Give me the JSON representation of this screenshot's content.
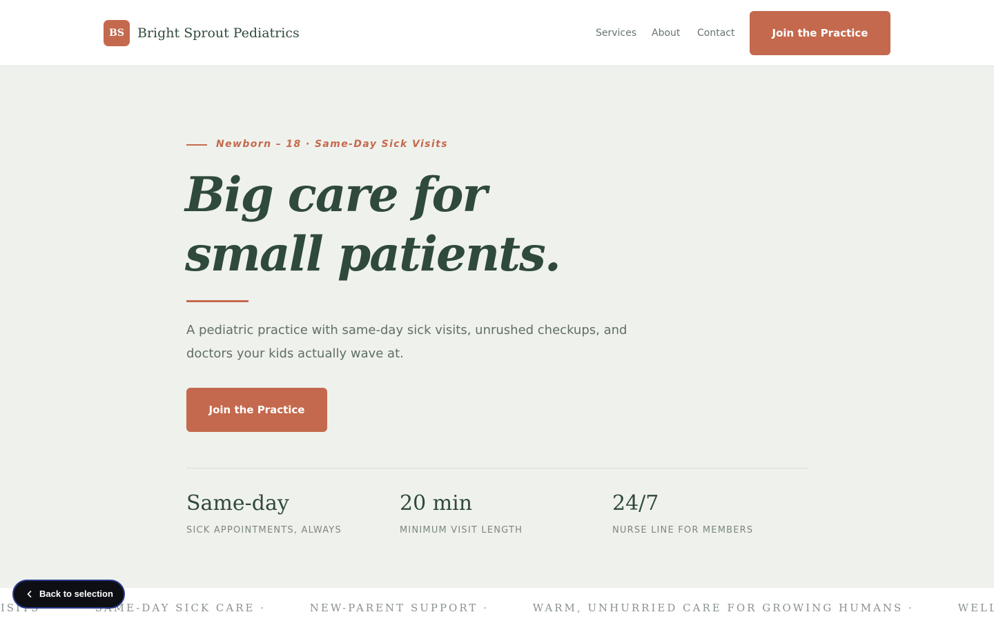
{
  "header": {
    "logo_initials": "BS",
    "brand_name": "Bright Sprout Pediatrics",
    "nav": [
      "Services",
      "About",
      "Contact"
    ],
    "cta_label": "Join the Practice"
  },
  "hero": {
    "eyebrow": "Newborn – 18 · Same-Day Sick Visits",
    "headline_line1": "Big care for",
    "headline_line2": "small patients.",
    "lede": "A pediatric practice with same-day sick visits, unrushed checkups, and doctors your kids actually wave at.",
    "cta_label": "Join the Practice"
  },
  "stats": [
    {
      "value": "Same-day",
      "label": "SICK APPOINTMENTS, ALWAYS"
    },
    {
      "value": "20 min",
      "label": "MINIMUM VISIT LENGTH"
    },
    {
      "value": "24/7",
      "label": "NURSE LINE FOR MEMBERS"
    }
  ],
  "marquee": [
    "VISITS ·",
    "SAME-DAY SICK CARE ·",
    "NEW-PARENT SUPPORT ·",
    "WARM, UNHURRIED CARE FOR GROWING HUMANS ·",
    "WELL-CHILD VISITS ·"
  ],
  "back_button": {
    "label": "Back to selection",
    "icon": "chevron-left-icon"
  },
  "colors": {
    "accent": "#c4694d",
    "primary_text": "#2f4a3a",
    "background": "#eff1ec",
    "surface": "#ffffff"
  }
}
